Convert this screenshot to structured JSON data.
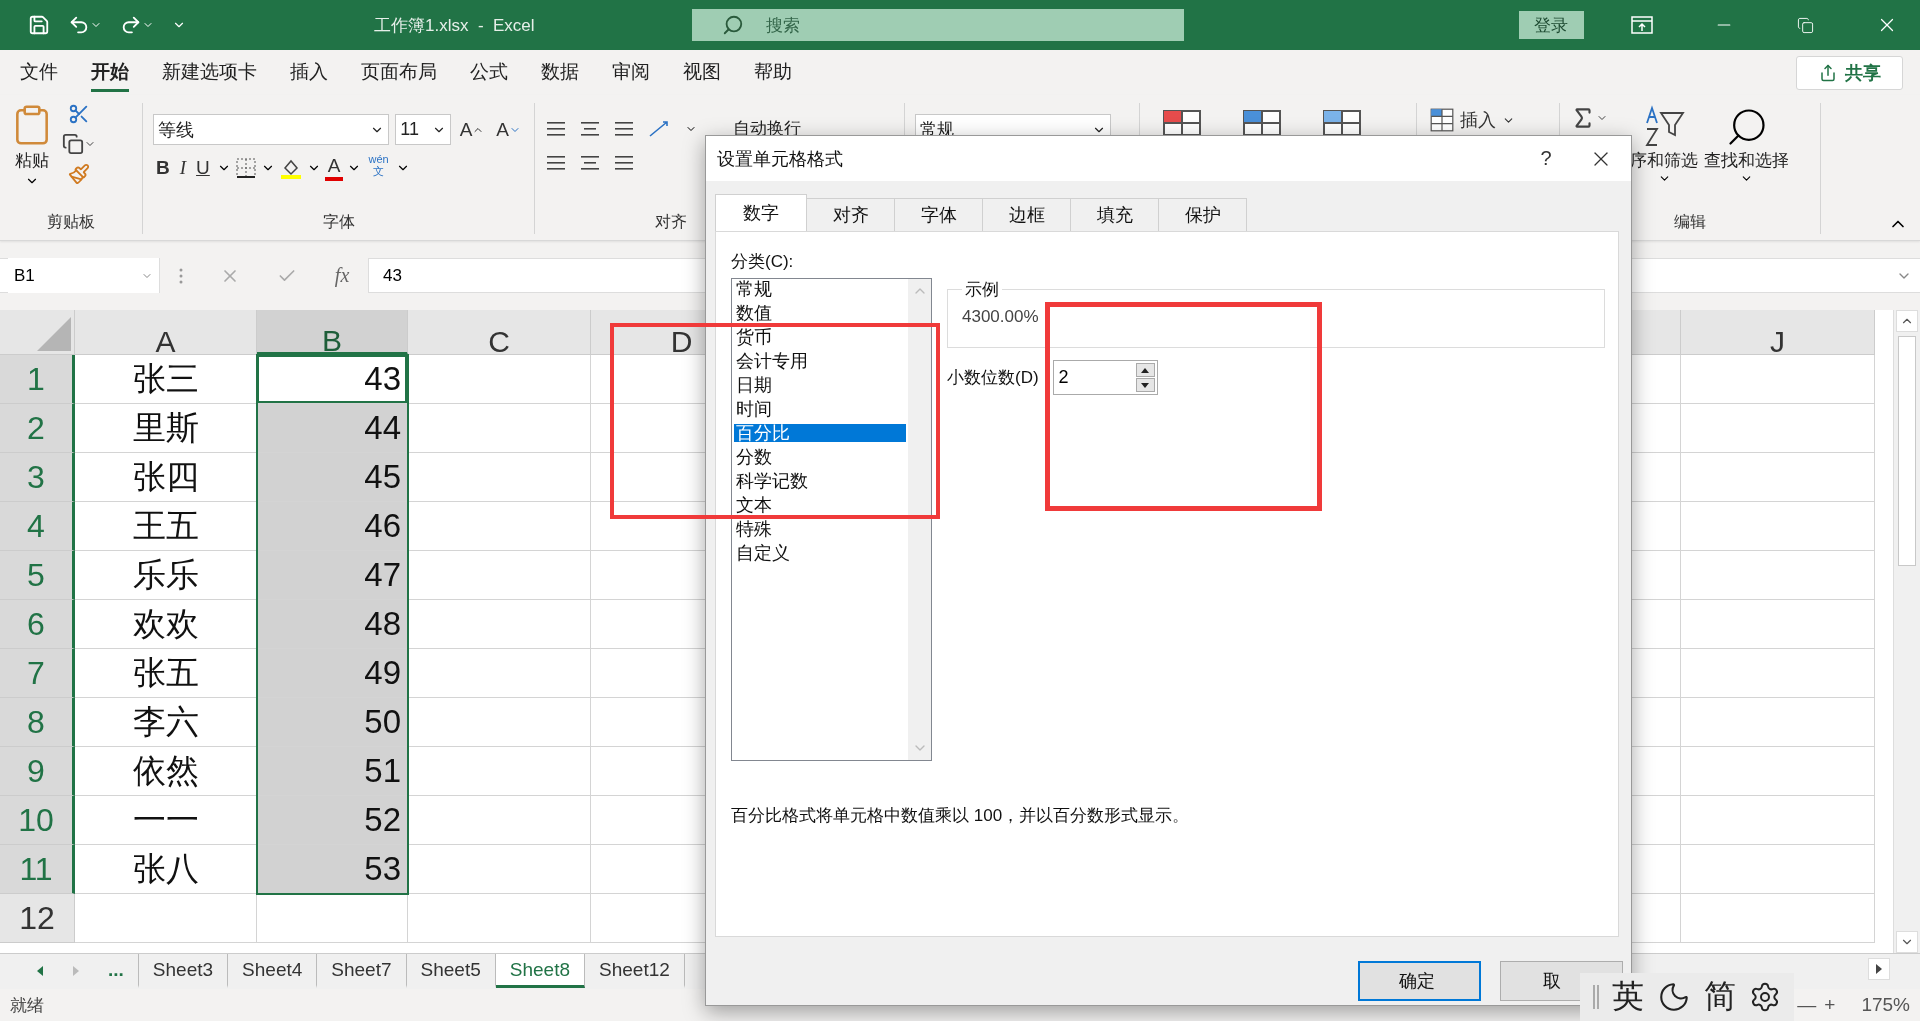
{
  "title_bar": {
    "title": "工作簿1.xlsx  -  Excel",
    "search_placeholder": "搜索",
    "sign_in": "登录"
  },
  "menu_tabs": [
    {
      "label": "文件",
      "selected": false
    },
    {
      "label": "开始",
      "selected": true
    },
    {
      "label": "新建选项卡",
      "selected": false
    },
    {
      "label": "插入",
      "selected": false
    },
    {
      "label": "页面布局",
      "selected": false
    },
    {
      "label": "公式",
      "selected": false
    },
    {
      "label": "数据",
      "selected": false
    },
    {
      "label": "审阅",
      "selected": false
    },
    {
      "label": "视图",
      "selected": false
    },
    {
      "label": "帮助",
      "selected": false
    }
  ],
  "share": "共享",
  "ribbon": {
    "clipboard": {
      "paste": "粘贴",
      "label": "剪贴板"
    },
    "font": {
      "name": "等线",
      "size": "11",
      "grow": "A",
      "shrink": "A",
      "bold": "B",
      "italic": "I",
      "underline": "U",
      "font_color": "A",
      "phonetic_top": "wén",
      "phonetic_bottom": "文",
      "label": "字体"
    },
    "alignment": {
      "wrap": "自动换行",
      "label": "对齐"
    },
    "number": {
      "format": "常规"
    },
    "cells": {
      "insert": "插入"
    },
    "editing": {
      "sort": "序和筛选",
      "find": "查找和选择",
      "label": "编辑"
    }
  },
  "formula_bar": {
    "name_box": "B1",
    "fx": "fx",
    "value": "43"
  },
  "columns": [
    {
      "label": "A",
      "selected": false
    },
    {
      "label": "B",
      "selected": true
    },
    {
      "label": "C",
      "selected": false
    },
    {
      "label": "D",
      "selected": false
    },
    {
      "label": "J",
      "selected": false
    }
  ],
  "rows": [
    {
      "header": "1",
      "selected": true,
      "cells": [
        {
          "text": "张三",
          "selected": false
        },
        {
          "text": "43",
          "selected": false,
          "active": true
        }
      ]
    },
    {
      "header": "2",
      "selected": true,
      "cells": [
        {
          "text": "里斯",
          "selected": false
        },
        {
          "text": "44",
          "selected": true,
          "active": false
        }
      ]
    },
    {
      "header": "3",
      "selected": true,
      "cells": [
        {
          "text": "张四",
          "selected": false
        },
        {
          "text": "45",
          "selected": true,
          "active": false
        }
      ]
    },
    {
      "header": "4",
      "selected": true,
      "cells": [
        {
          "text": "王五",
          "selected": false
        },
        {
          "text": "46",
          "selected": true,
          "active": false
        }
      ]
    },
    {
      "header": "5",
      "selected": true,
      "cells": [
        {
          "text": "乐乐",
          "selected": false
        },
        {
          "text": "47",
          "selected": true,
          "active": false
        }
      ]
    },
    {
      "header": "6",
      "selected": true,
      "cells": [
        {
          "text": "欢欢",
          "selected": false
        },
        {
          "text": "48",
          "selected": true,
          "active": false
        }
      ]
    },
    {
      "header": "7",
      "selected": true,
      "cells": [
        {
          "text": "张五",
          "selected": false
        },
        {
          "text": "49",
          "selected": true,
          "active": false
        }
      ]
    },
    {
      "header": "8",
      "selected": true,
      "cells": [
        {
          "text": "李六",
          "selected": false
        },
        {
          "text": "50",
          "selected": true,
          "active": false
        }
      ]
    },
    {
      "header": "9",
      "selected": true,
      "cells": [
        {
          "text": "依然",
          "selected": false
        },
        {
          "text": "51",
          "selected": true,
          "active": false
        }
      ]
    },
    {
      "header": "10",
      "selected": true,
      "cells": [
        {
          "text": "一一",
          "selected": false
        },
        {
          "text": "52",
          "selected": true,
          "active": false
        }
      ]
    },
    {
      "header": "11",
      "selected": true,
      "cells": [
        {
          "text": "张八",
          "selected": false
        },
        {
          "text": "53",
          "selected": true,
          "active": false
        }
      ]
    },
    {
      "header": "12",
      "selected": false
    }
  ],
  "sheet_tabs": [
    {
      "label": "...",
      "selected": false
    },
    {
      "label": "Sheet3",
      "selected": false
    },
    {
      "label": "Sheet4",
      "selected": false
    },
    {
      "label": "Sheet7",
      "selected": false
    },
    {
      "label": "Sheet5",
      "selected": false
    },
    {
      "label": "Sheet8",
      "selected": true
    },
    {
      "label": "Sheet12",
      "selected": false
    }
  ],
  "status_bar": {
    "ready": "就绪",
    "zoom_minus": "—",
    "zoom_plus": "+",
    "zoom": "175%"
  },
  "dialog": {
    "title": "设置单元格格式",
    "help": "?",
    "tabs": [
      {
        "label": "数字",
        "selected": true
      },
      {
        "label": "对齐",
        "selected": false
      },
      {
        "label": "字体",
        "selected": false
      },
      {
        "label": "边框",
        "selected": false
      },
      {
        "label": "填充",
        "selected": false
      },
      {
        "label": "保护",
        "selected": false
      }
    ],
    "category_label": "分类(C):",
    "categories": [
      {
        "label": "常规",
        "selected": false
      },
      {
        "label": "数值",
        "selected": false
      },
      {
        "label": "货币",
        "selected": false
      },
      {
        "label": "会计专用",
        "selected": false
      },
      {
        "label": "日期",
        "selected": false
      },
      {
        "label": "时间",
        "selected": false
      },
      {
        "label": "百分比",
        "selected": true
      },
      {
        "label": "分数",
        "selected": false
      },
      {
        "label": "科学记数",
        "selected": false
      },
      {
        "label": "文本",
        "selected": false
      },
      {
        "label": "特殊",
        "selected": false
      },
      {
        "label": "自定义",
        "selected": false
      }
    ],
    "sample_label": "示例",
    "sample_value": "4300.00%",
    "decimals_label": "小数位数(D)",
    "decimals_value": "2",
    "description": "百分比格式将单元格中数值乘以 100，并以百分数形式显示。",
    "buttons": [
      {
        "label": "确定",
        "kind": "default"
      },
      {
        "label": "取",
        "kind": "normal"
      }
    ]
  },
  "ime_bar": {
    "language": "英",
    "script": "简"
  },
  "annotation_boxes": [
    {
      "color": "#f03a3a"
    },
    {
      "color": "#f03a3a"
    }
  ]
}
